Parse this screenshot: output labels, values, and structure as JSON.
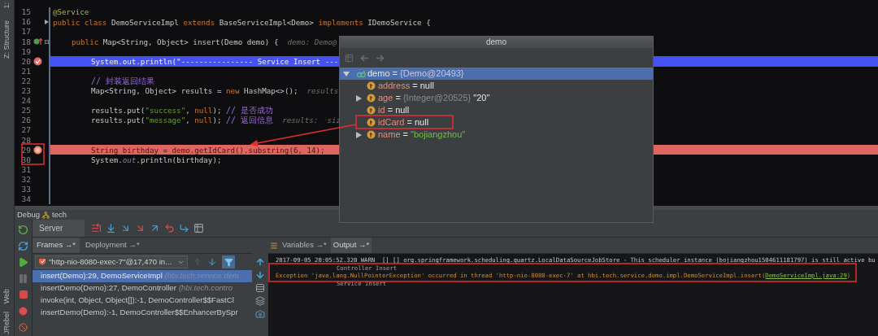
{
  "left_strip": {
    "top": [
      "1:",
      "Z: Structure"
    ],
    "bottom": [
      "Web",
      "JRebel"
    ]
  },
  "editor": {
    "lines": [
      {
        "number": "15",
        "kind": "class",
        "tokens": [
          {
            "t": "@Service",
            "kind": "ann"
          }
        ]
      },
      {
        "number": "16",
        "kind": "class",
        "fold": {
          "kind": "arrow"
        },
        "tokens": [
          {
            "t": "public class ",
            "kind": "kw"
          },
          {
            "t": "DemoServiceImpl ",
            "kind": "plain"
          },
          {
            "t": "extends ",
            "kind": "kw"
          },
          {
            "t": "BaseServiceImpl<Demo> ",
            "kind": "plain"
          },
          {
            "t": "implements ",
            "kind": "kw"
          },
          {
            "t": "IDemoService {",
            "kind": "plain"
          }
        ]
      },
      {
        "number": "17"
      },
      {
        "number": "18",
        "kind": "method",
        "marker": {
          "kind": "override"
        },
        "fold": {
          "kind": "collapse"
        },
        "tokens": [
          {
            "t": "public ",
            "kind": "kw"
          },
          {
            "t": "Map<String, Object> insert(Demo demo) {",
            "kind": "plain"
          },
          {
            "t": "  demo: Demo@",
            "kind": "hint"
          }
        ]
      },
      {
        "number": "19"
      },
      {
        "number": "20",
        "kind": "body",
        "marker": {
          "kind": "breakpoint_verified"
        },
        "highlight": {
          "kind": "execution"
        },
        "tokens": [
          {
            "t": "System.out.println(\"---------------- Service Insert ---",
            "kind": "plain"
          }
        ]
      },
      {
        "number": "21"
      },
      {
        "number": "22",
        "kind": "body",
        "tokens": [
          {
            "t": "// 封装返回结果",
            "kind": "comment"
          }
        ]
      },
      {
        "number": "23",
        "kind": "body",
        "tokens": [
          {
            "t": "Map<String, Object> results = ",
            "kind": "plain"
          },
          {
            "t": "new ",
            "kind": "kw"
          },
          {
            "t": "HashMap<>();",
            "kind": "plain"
          },
          {
            "t": "  results",
            "kind": "hint"
          }
        ]
      },
      {
        "number": "24"
      },
      {
        "number": "25",
        "kind": "body",
        "tokens": [
          {
            "t": "results.put(",
            "kind": "plain"
          },
          {
            "t": "\"success\"",
            "kind": "str"
          },
          {
            "t": ", ",
            "kind": "plain"
          },
          {
            "t": "null",
            "kind": "kw"
          },
          {
            "t": "); ",
            "kind": "plain"
          },
          {
            "t": "// 是否成功",
            "kind": "comment"
          }
        ]
      },
      {
        "number": "26",
        "kind": "body",
        "tokens": [
          {
            "t": "results.put(",
            "kind": "plain"
          },
          {
            "t": "\"message\"",
            "kind": "str"
          },
          {
            "t": ", ",
            "kind": "plain"
          },
          {
            "t": "null",
            "kind": "kw"
          },
          {
            "t": "); ",
            "kind": "plain"
          },
          {
            "t": "// 返回信息",
            "kind": "comment"
          },
          {
            "t": "  results:  siz",
            "kind": "hint"
          }
        ]
      },
      {
        "number": "27"
      },
      {
        "number": "28"
      },
      {
        "number": "29",
        "kind": "body",
        "marker": {
          "kind": "breakpoint"
        },
        "highlight": {
          "kind": "breakpoint"
        },
        "tokens": [
          {
            "t": "String birthday = demo.getIdCard().substring(6, 14);",
            "kind": "plain"
          }
        ]
      },
      {
        "number": "30",
        "kind": "body",
        "tokens": [
          {
            "t": "System.",
            "kind": "plain"
          },
          {
            "t": "out",
            "kind": "field"
          },
          {
            "t": ".println(birthday);",
            "kind": "plain"
          }
        ]
      },
      {
        "number": "31"
      },
      {
        "number": "32"
      },
      {
        "number": "33"
      },
      {
        "number": "34"
      }
    ]
  },
  "popup": {
    "title": "demo",
    "tree": [
      {
        "name": "demo",
        "op": "=",
        "type": "{Demo@20493}",
        "expanded": true,
        "selected": true,
        "children": [
          {
            "name": "address",
            "op": "=",
            "value": "null",
            "kind": "null"
          },
          {
            "name": "age",
            "op": "=",
            "type": "{Integer@20525}",
            "value": "\"20\"",
            "kind": "object",
            "expanded": false
          },
          {
            "name": "id",
            "op": "=",
            "value": "null",
            "kind": "null"
          },
          {
            "name": "idCard",
            "op": "=",
            "value": "null",
            "kind": "null"
          },
          {
            "name": "name",
            "op": "=",
            "value": "\"bojiangzhou\"",
            "kind": "string",
            "expanded": false
          }
        ]
      }
    ]
  },
  "debug": {
    "title": "Debug",
    "config": "tech",
    "server_tab": "Server",
    "frame_tabs": [
      {
        "label": "Frames →*",
        "selected": true
      },
      {
        "label": "Deployment →*",
        "selected": false
      }
    ],
    "output_tabs": [
      {
        "label": "Variables →*",
        "selected": false
      },
      {
        "label": "Output →*",
        "selected": true
      }
    ],
    "thread": "\"http-nio-8080-exec-7\"@17,470 in...",
    "frames": [
      {
        "method": "insert(Demo):29, DemoServiceImpl",
        "package": "(hbi.tech.service.dem",
        "selected": true
      },
      {
        "method": "insertDemo(Demo):27, DemoController",
        "package": "(hbi.tech.contro",
        "selected": false
      },
      {
        "method": "invoke(int, Object, Object[]):-1, DemoController$$FastCl",
        "selected": false
      },
      {
        "method": "insertDemo(Demo):-1, DemoController$$EnhancerBySpr",
        "selected": false
      }
    ],
    "console": [
      {
        "kind": "log",
        "text": "2017-09-05 20:05:52.320 WARN  [] [] org.springframework.scheduling.quartz.LocalDataSourceJobStore - This scheduler instance (bojiangzhou1504611181797) is still active bu"
      },
      {
        "kind": "print",
        "text": "Controller Insert"
      },
      {
        "kind": "exception",
        "text": "Exception 'java.lang.NullPointerException' occurred in thread 'http-nio-8080-exec-7' at hbi.tech.service.demo.impl.DemoServiceImpl.insert(",
        "link": "DemoServiceImpl.java:29",
        "after": ")"
      },
      {
        "kind": "print",
        "text": "Service Insert"
      }
    ]
  }
}
